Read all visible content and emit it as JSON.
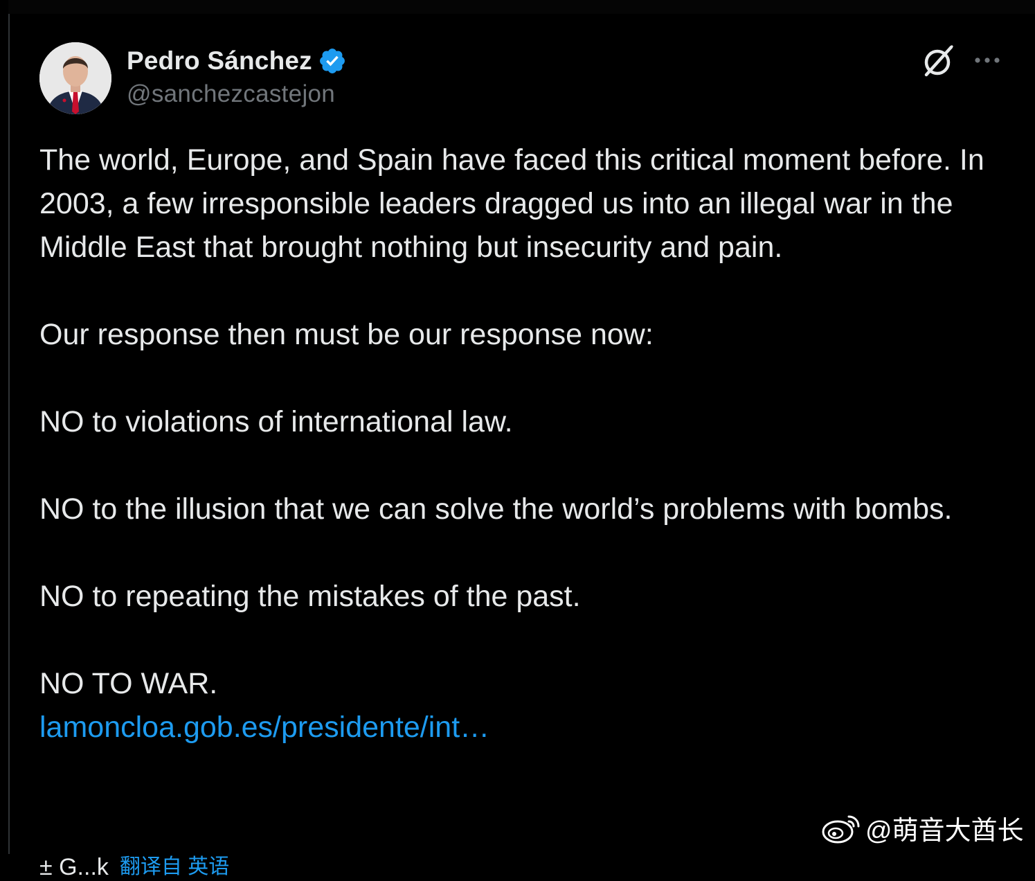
{
  "post": {
    "author": {
      "display_name": "Pedro Sánchez",
      "handle": "@sanchezcastejon",
      "verified": true,
      "avatar_icon": "profile-photo"
    },
    "header_actions": {
      "grok_icon": "grok-slash-icon",
      "more_icon": "ellipsis-icon"
    },
    "body": {
      "paragraph_1": "The world, Europe, and Spain have faced this critical moment before. In 2003, a few irresponsible leaders dragged us into an illegal war in the Middle East that brought nothing but insecurity and pain.",
      "paragraph_2": "Our response then must be our response now:",
      "paragraph_3": "NO to violations of international law.",
      "paragraph_4": "NO to the illusion that we can solve the world’s problems with bombs.",
      "paragraph_5": "NO to repeating the mistakes of the past.",
      "paragraph_6": "NO TO WAR.",
      "link_text": "lamoncloa.gob.es/presidente/int…"
    },
    "cut_off_row": {
      "left_text": "± G...k",
      "translate_text": "翻译自 英语"
    }
  },
  "watermark": {
    "text": "@萌音大酋长",
    "icon": "weibo-icon"
  },
  "colors": {
    "background": "#000000",
    "text": "#e7e9ea",
    "muted": "#71767b",
    "accent": "#1d9bf0"
  }
}
